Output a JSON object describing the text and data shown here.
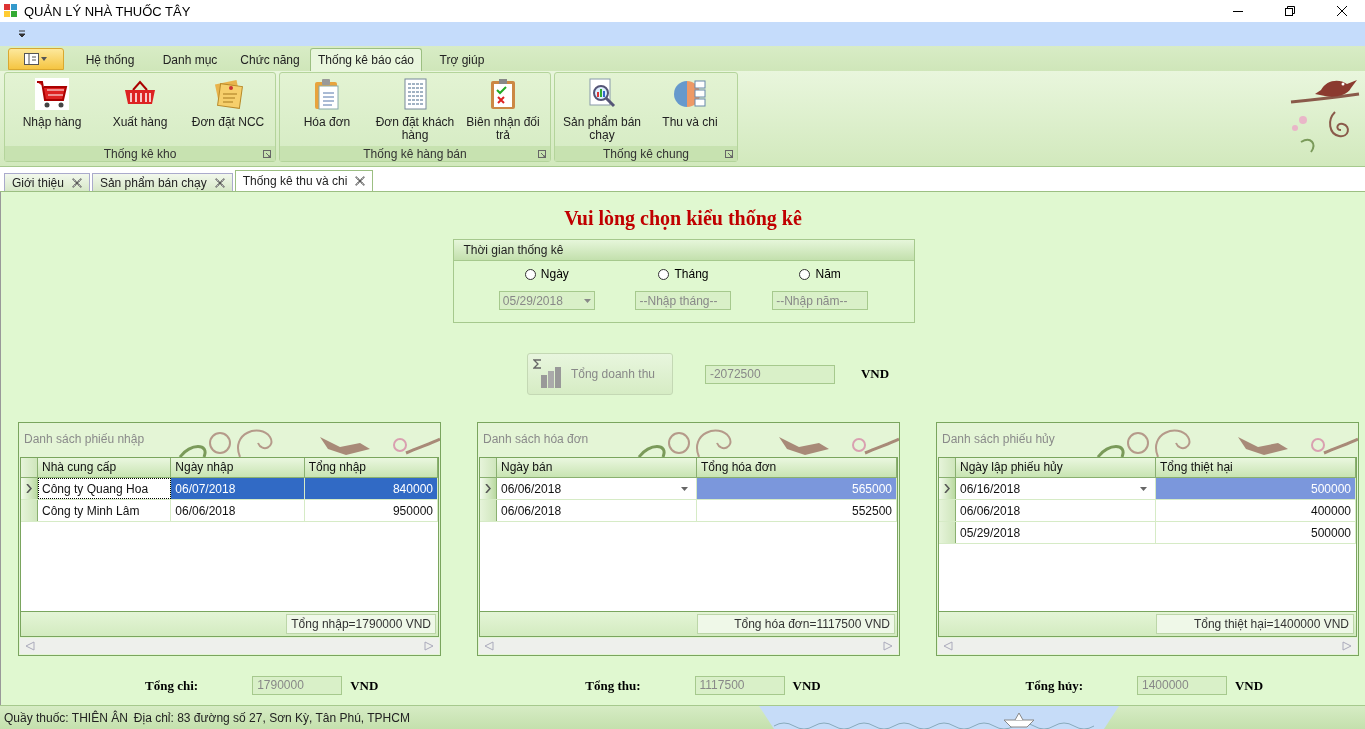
{
  "window": {
    "title": "QUẢN LÝ NHÀ THUỐC TÂY"
  },
  "ribbon": {
    "tabs": [
      {
        "label": "Hệ thống",
        "selected": false
      },
      {
        "label": "Danh mục",
        "selected": false
      },
      {
        "label": "Chức năng",
        "selected": false
      },
      {
        "label": "Thống kê báo cáo",
        "selected": true
      },
      {
        "label": "Trợ giúp",
        "selected": false
      }
    ],
    "groups": [
      {
        "label": "Thống kê kho",
        "buttons": [
          {
            "label": "Nhập hàng"
          },
          {
            "label": "Xuất hàng"
          },
          {
            "label": "Đơn đặt NCC"
          }
        ]
      },
      {
        "label": "Thống kê hàng bán",
        "buttons": [
          {
            "label": "Hóa đơn"
          },
          {
            "label": "Đơn đặt khách hàng"
          },
          {
            "label": "Biên nhận đối trả"
          }
        ]
      },
      {
        "label": "Thống kê chung",
        "buttons": [
          {
            "label": "Sản phẩm bán chạy"
          },
          {
            "label": "Thu và chi"
          }
        ]
      }
    ]
  },
  "doc_tabs": [
    {
      "label": "Giới thiệu",
      "selected": false
    },
    {
      "label": "Sản phẩm bán chạy",
      "selected": false
    },
    {
      "label": "Thống kê thu và chi",
      "selected": true
    }
  ],
  "content": {
    "heading": "Vui lòng chọn kiểu thống kê",
    "time_group": {
      "title": "Thời gian thống kê",
      "options": [
        {
          "label": "Ngày",
          "selected": false,
          "kind": "date",
          "value": "05/29/2018",
          "disabled": true
        },
        {
          "label": "Tháng",
          "selected": false,
          "kind": "text",
          "placeholder": "--Nhập tháng--",
          "disabled": true
        },
        {
          "label": "Năm",
          "selected": false,
          "kind": "text",
          "placeholder": "--Nhập năm--",
          "disabled": true
        }
      ]
    },
    "revenue": {
      "button": "Tổng doanh thu",
      "disabled": true,
      "value": "-2072500",
      "unit": "VND"
    },
    "panels": [
      {
        "title": "Danh sách phiếu nhập",
        "focused": true,
        "columns": [
          "Nhà cung cấp",
          "Ngày nhập",
          "Tổng nhập"
        ],
        "rows": [
          {
            "cells": [
              "Công ty Quang Hoa",
              "06/07/2018",
              "840000"
            ],
            "selected": true
          },
          {
            "cells": [
              "Công ty Minh Lâm",
              "06/06/2018",
              "950000"
            ],
            "selected": false
          }
        ],
        "summary": "Tổng nhập=1790000 VND"
      },
      {
        "title": "Danh sách hóa đơn",
        "focused": false,
        "columns": [
          "Ngày bán",
          "Tổng hóa đơn"
        ],
        "rows": [
          {
            "cells": [
              "06/06/2018",
              "565000"
            ],
            "selected": true
          },
          {
            "cells": [
              "06/06/2018",
              "552500"
            ],
            "selected": false
          }
        ],
        "summary": "Tổng hóa đơn=1117500 VND"
      },
      {
        "title": "Danh sách phiếu hủy",
        "focused": false,
        "columns": [
          "Ngày lập phiếu hủy",
          "Tổng thiệt hại"
        ],
        "rows": [
          {
            "cells": [
              "06/16/2018",
              "500000"
            ],
            "selected": true
          },
          {
            "cells": [
              "06/06/2018",
              "400000"
            ],
            "selected": false
          },
          {
            "cells": [
              "05/29/2018",
              "500000"
            ],
            "selected": false
          }
        ],
        "summary": "Tổng thiệt hại=1400000 VND"
      }
    ],
    "totals": [
      {
        "label": "Tổng chi:",
        "value": "1790000",
        "unit": "VND"
      },
      {
        "label": "Tổng thu:",
        "value": "1117500",
        "unit": "VND"
      },
      {
        "label": "Tổng hủy:",
        "value": "1400000",
        "unit": "VND"
      }
    ]
  },
  "status_bar": {
    "store": "Quầy thuốc: THIÊN ÂN",
    "address": "Địa chỉ: 83 đường số 27, Sơn Kỳ, Tân Phú, TPHCM"
  }
}
